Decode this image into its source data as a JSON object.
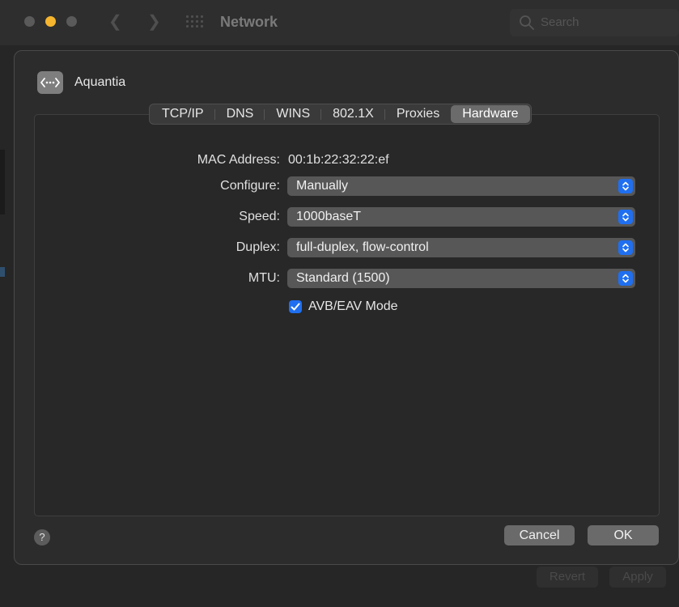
{
  "window": {
    "title": "Network",
    "search_placeholder": "Search",
    "revert_label": "Revert",
    "apply_label": "Apply"
  },
  "sheet": {
    "interface_name": "Aquantia",
    "interface_icon": "ethernet-icon",
    "tabs": [
      {
        "label": "TCP/IP",
        "active": false
      },
      {
        "label": "DNS",
        "active": false
      },
      {
        "label": "WINS",
        "active": false
      },
      {
        "label": "802.1X",
        "active": false
      },
      {
        "label": "Proxies",
        "active": false
      },
      {
        "label": "Hardware",
        "active": true
      }
    ],
    "mac_label": "MAC Address:",
    "mac_value": "00:1b:22:32:22:ef",
    "configure_label": "Configure:",
    "configure_value": "Manually",
    "speed_label": "Speed:",
    "speed_value": "1000baseT",
    "duplex_label": "Duplex:",
    "duplex_value": "full-duplex, flow-control",
    "mtu_label": "MTU:",
    "mtu_value": "Standard (1500)",
    "avb_label": "AVB/EAV Mode",
    "avb_checked": true,
    "help_label": "?",
    "cancel_label": "Cancel",
    "ok_label": "OK"
  },
  "colors": {
    "accent": "#1f6ff0",
    "minimize": "#f5b52e"
  }
}
